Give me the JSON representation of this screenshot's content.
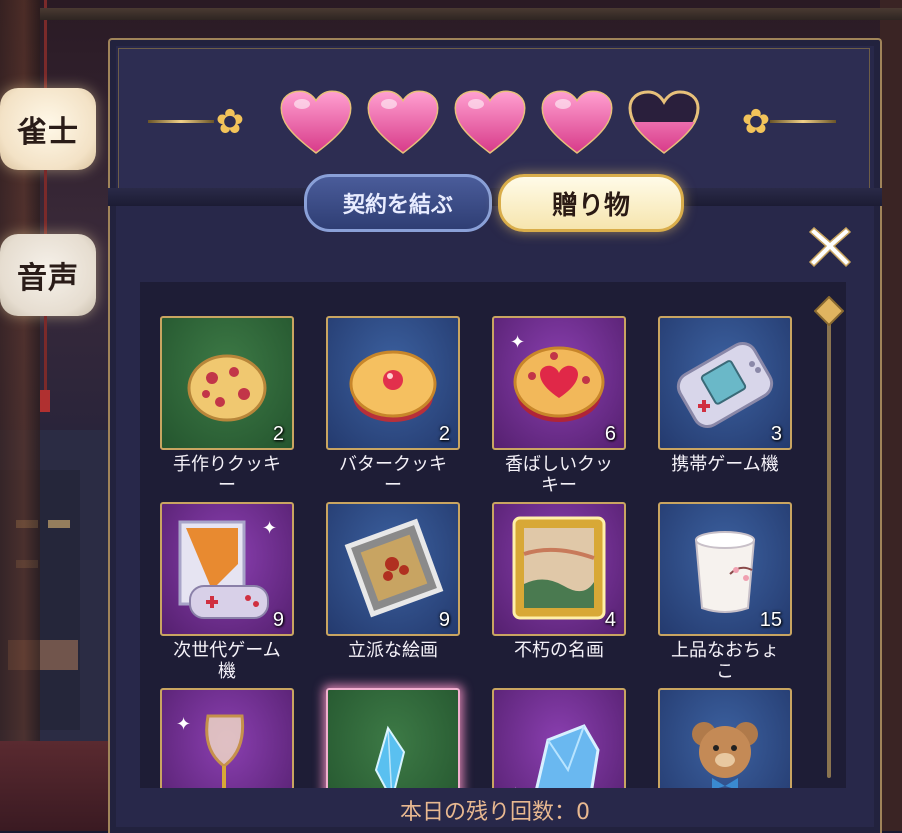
{
  "side_tabs": [
    {
      "label": "雀士"
    },
    {
      "label": "音声"
    }
  ],
  "affection": {
    "hearts_total": 5,
    "hearts_filled": 4.5
  },
  "tabs": {
    "contract": "契約を結ぶ",
    "gift": "贈り物"
  },
  "gift_items": [
    {
      "name": "手作りクッキー",
      "count": "2",
      "rarity": "green",
      "icon": "cookie-icon"
    },
    {
      "name": "バタークッキー",
      "count": "2",
      "rarity": "blue",
      "icon": "jam-cookie-icon"
    },
    {
      "name": "香ばしいクッキー",
      "count": "6",
      "rarity": "purple",
      "icon": "heart-cookie-icon"
    },
    {
      "name": "携帯ゲーム機",
      "count": "3",
      "rarity": "blue",
      "icon": "handheld-console-icon"
    },
    {
      "name": "次世代ゲーム機",
      "count": "9",
      "rarity": "purple",
      "icon": "game-console-box-icon"
    },
    {
      "name": "立派な絵画",
      "count": "9",
      "rarity": "blue",
      "icon": "painting-icon"
    },
    {
      "name": "不朽の名画",
      "count": "4",
      "rarity": "purple",
      "icon": "masterpiece-painting-icon"
    },
    {
      "name": "上品なおちょこ",
      "count": "15",
      "rarity": "blue",
      "icon": "sake-cup-icon"
    },
    {
      "name": "",
      "count": "",
      "rarity": "purple",
      "icon": "wine-glass-icon"
    },
    {
      "name": "",
      "count": "",
      "rarity": "green",
      "icon": "crystal-icon",
      "selected": true
    },
    {
      "name": "",
      "count": "",
      "rarity": "purple",
      "icon": "gem-icon"
    },
    {
      "name": "",
      "count": "",
      "rarity": "blue",
      "icon": "teddy-bear-icon"
    }
  ],
  "labels": [
    "手作りクッキ\nー",
    "バタークッキ\nー",
    "香ばしいクッ\nキー",
    "携帯ゲーム機",
    "次世代ゲーム\n機",
    "立派な絵画",
    "不朽の名画",
    "上品なおちょ\nこ"
  ],
  "footer": {
    "remaining": "本日の残り回数：0"
  },
  "colors": {
    "panel": "#28284a",
    "gold": "#c9a561",
    "heart": "#f06aa8",
    "footer_text": "#e8b890"
  }
}
